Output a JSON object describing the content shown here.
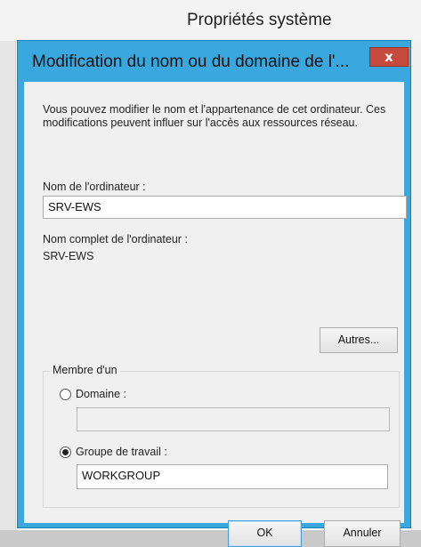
{
  "parent_window": {
    "title": "Propriétés système"
  },
  "dialog": {
    "title": "Modification du nom ou du domaine de l'...",
    "close_symbol": "x",
    "description": "Vous pouvez modifier le nom et l'appartenance de cet ordinateur. Ces modifications peuvent influer sur l'accès aux ressources réseau.",
    "computer_name": {
      "label": "Nom de l'ordinateur :",
      "value": "SRV-EWS"
    },
    "full_computer_name": {
      "label": "Nom complet de l'ordinateur :",
      "value": "SRV-EWS"
    },
    "more_button": "Autres...",
    "member_of": {
      "legend": "Membre d'un",
      "domain": {
        "label": "Domaine :",
        "selected": false,
        "value": ""
      },
      "workgroup": {
        "label": "Groupe de travail :",
        "selected": true,
        "value": "WORKGROUP"
      }
    },
    "ok_button": "OK",
    "cancel_button": "Annuler"
  },
  "colors": {
    "dialog_border": "#3aa8de",
    "close_button": "#c74b3c",
    "client_background": "#f0f0f0"
  }
}
